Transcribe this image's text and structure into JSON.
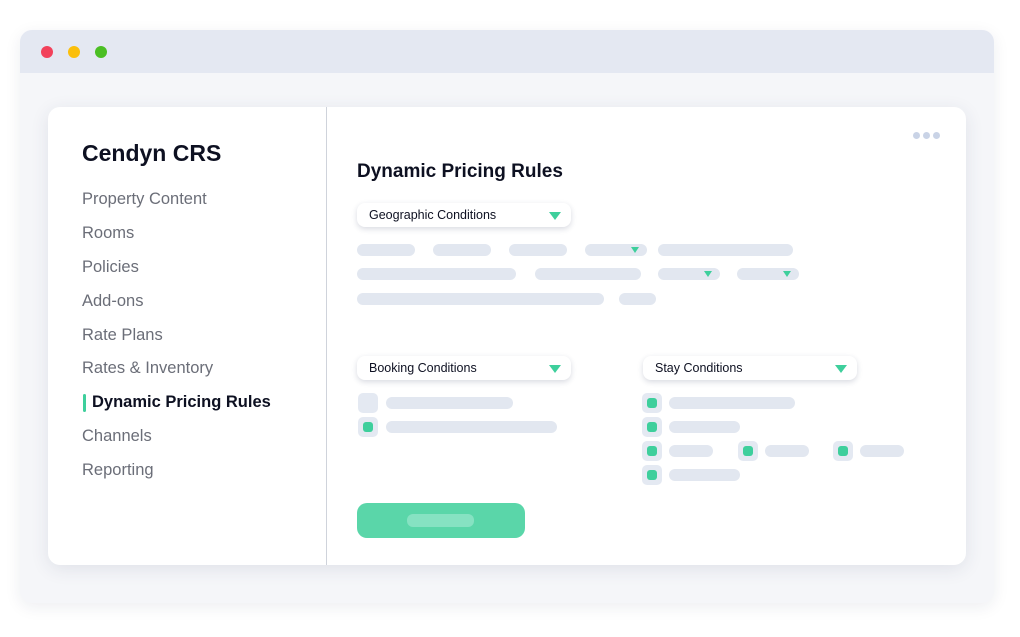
{
  "sidebar": {
    "brand": "Cendyn CRS",
    "items": [
      {
        "label": "Property Content",
        "active": false
      },
      {
        "label": "Rooms",
        "active": false
      },
      {
        "label": "Policies",
        "active": false
      },
      {
        "label": "Add-ons",
        "active": false
      },
      {
        "label": "Rate Plans",
        "active": false
      },
      {
        "label": "Rates & Inventory",
        "active": false
      },
      {
        "label": "Dynamic Pricing Rules",
        "active": true
      },
      {
        "label": "Channels",
        "active": false
      },
      {
        "label": "Reporting",
        "active": false
      }
    ]
  },
  "main": {
    "title": "Dynamic Pricing Rules",
    "geographic": {
      "label": "Geographic Conditions"
    },
    "booking": {
      "label": "Booking Conditions"
    },
    "stay": {
      "label": "Stay Conditions"
    }
  },
  "colors": {
    "accent": "#3ecf9c",
    "button": "#5ad6a9",
    "placeholder": "#e2e7f0",
    "window_dot_red": "#f2415b",
    "window_dot_yellow": "#fbbf0c",
    "window_dot_green": "#4bbf24"
  },
  "icons": {
    "more": "more-horizontal-icon",
    "dropdown": "caret-down-icon"
  }
}
